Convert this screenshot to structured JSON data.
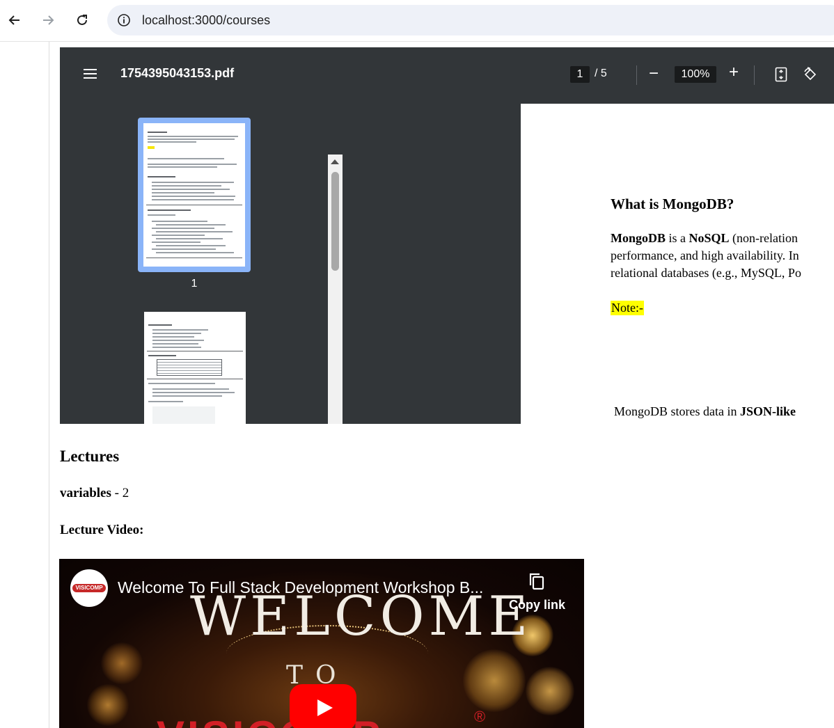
{
  "browser": {
    "url": "localhost:3000/courses"
  },
  "pdf": {
    "filename": "1754395043153.pdf",
    "current_page": "1",
    "page_separator": "/ 5",
    "zoom": "100%",
    "thumbnail_label": "1",
    "page": {
      "heading": "What is MongoDB?",
      "para_bold1": "MongoDB",
      "para_text1": " is a ",
      "para_bold2": "NoSQL",
      "para_text2": " (non-relation",
      "para_line2": "performance, and high availability. In",
      "para_line3": "relational databases (e.g., MySQL, Po",
      "note": "Note:-",
      "bottom_text": "MongoDB stores data in ",
      "bottom_bold": "JSON-like"
    }
  },
  "content": {
    "lectures_heading": "Lectures",
    "lecture_name": "variables",
    "lecture_rest": " - 2",
    "video_label": "Lecture Video:"
  },
  "video": {
    "title": "Welcome To Full Stack Development Workshop B...",
    "copy_link": "Copy link",
    "channel_logo_text": "VISICOMP",
    "overlay_welcome": "WELCOME",
    "overlay_to": "TO",
    "overlay_brand": "VISICOMP",
    "overlay_reg": "®"
  },
  "colors": {
    "pdf_toolbar": "#323639",
    "thumb_selected": "#8ab4f8",
    "highlight": "#ffff00",
    "youtube_red": "#ff0000"
  },
  "icons": [
    "back-arrow-icon",
    "forward-arrow-icon",
    "reload-icon",
    "info-icon",
    "menu-icon",
    "fit-page-icon",
    "rotate-icon",
    "copy-icon",
    "play-icon"
  ]
}
